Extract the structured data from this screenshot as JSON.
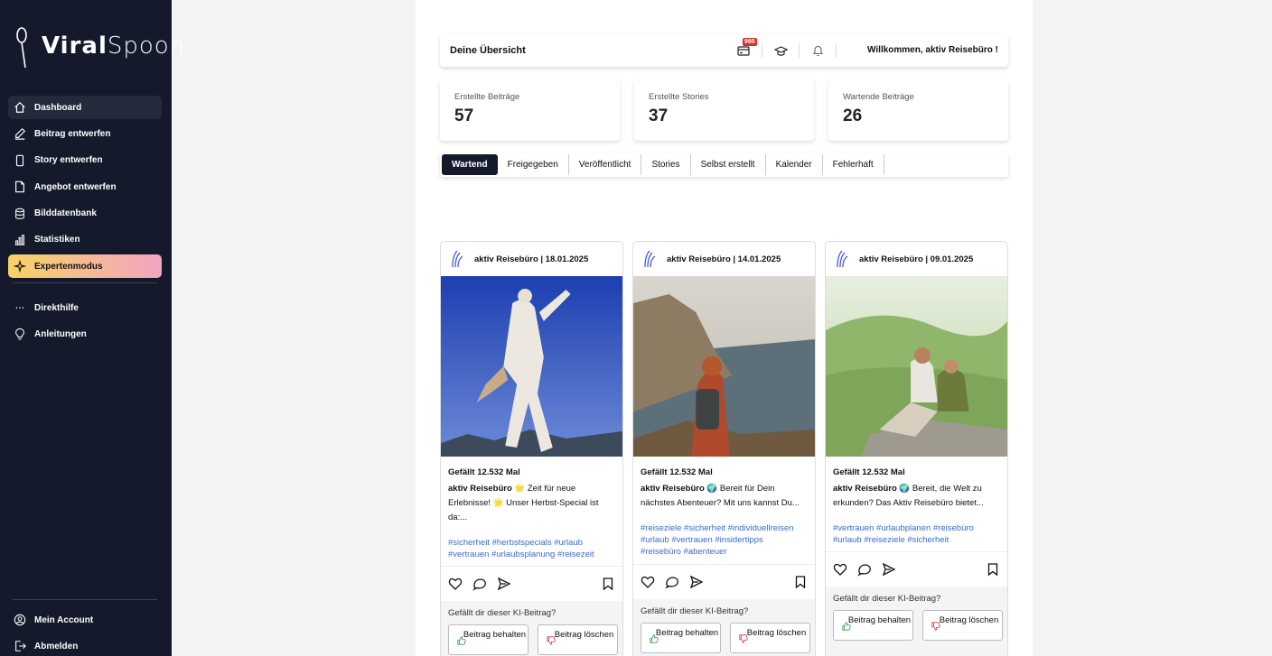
{
  "brand": {
    "part1": "Viral",
    "part2": "Spoon"
  },
  "sidebar": {
    "items": [
      {
        "label": "Dashboard",
        "icon": "home-icon"
      },
      {
        "label": "Beitrag entwerfen",
        "icon": "edit-icon"
      },
      {
        "label": "Story entwerfen",
        "icon": "phone-icon"
      },
      {
        "label": "Angebot entwerfen",
        "icon": "document-icon"
      },
      {
        "label": "Bilddatenbank",
        "icon": "database-icon"
      },
      {
        "label": "Statistiken",
        "icon": "bar-chart-icon"
      },
      {
        "label": "Expertenmodus",
        "icon": "sparkle-icon"
      }
    ],
    "help": [
      {
        "label": "Direkthilfe",
        "icon": "dots-icon"
      },
      {
        "label": "Anleitungen",
        "icon": "lightbulb-icon"
      }
    ],
    "bottom": [
      {
        "label": "Mein Account",
        "icon": "user-icon"
      },
      {
        "label": "Abmelden",
        "icon": "logout-icon"
      }
    ]
  },
  "header": {
    "title": "Deine Übersicht",
    "badge_count": "995",
    "welcome": "Willkommen, aktiv Reisebüro !"
  },
  "stats": [
    {
      "label": "Erstellte Beiträge",
      "value": "57"
    },
    {
      "label": "Erstellte Stories",
      "value": "37"
    },
    {
      "label": "Wartende Beiträge",
      "value": "26"
    }
  ],
  "tabs": [
    "Wartend",
    "Freigegeben",
    "Veröffentlicht",
    "Stories",
    "Selbst erstellt",
    "Kalender",
    "Fehlerhaft"
  ],
  "posts": [
    {
      "author": "aktiv Reisebüro | 18.01.2025",
      "likes": "Gefällt 12.532 Mal",
      "name": "aktiv Reisebüro",
      "caption": "🌟 Zeit für neue Erlebnisse! 🌟 Unser Herbst-Special ist da:...",
      "tags_line1": "#sicherheit #herbstspecials #urlaub",
      "tags_line2": "#vertrauen #urlaubsplanung #reisezeit",
      "tags_line3": "",
      "question": "Gefällt dir dieser KI-Beitrag?",
      "keep": "Beitrag behalten",
      "delete": "Beitrag löschen"
    },
    {
      "author": "aktiv Reisebüro | 14.01.2025",
      "likes": "Gefällt 12.532 Mal",
      "name": "aktiv Reisebüro",
      "caption": "🌍 Bereit für Dein nächstes Abenteuer? Mit uns kannst Du...",
      "tags_line1": "#reiseziele #sicherheit #individuellreisen",
      "tags_line2": "#urlaub #vertrauen #insidertipps",
      "tags_line3": "#reisebüro #abenteuer",
      "question": "Gefällt dir dieser KI-Beitrag?",
      "keep": "Beitrag behalten",
      "delete": "Beitrag löschen"
    },
    {
      "author": "aktiv Reisebüro | 09.01.2025",
      "likes": "Gefällt 12.532 Mal",
      "name": "aktiv Reisebüro",
      "caption": "🌍 Bereit, die Welt zu erkunden? Das Aktiv Reisebüro bietet...",
      "tags_line1": "#vertrauen #urlaubplanen #reisebüro",
      "tags_line2": "#urlaub #reiseziele #sicherheit",
      "tags_line3": "",
      "question": "Gefällt dir dieser KI-Beitrag?",
      "keep": "Beitrag behalten",
      "delete": "Beitrag löschen"
    }
  ],
  "colors": {
    "sidebar_bg": "#141a2b",
    "active_tab": "#141a2b",
    "hashtag": "#3b6ccf",
    "badge": "#d32f2f"
  }
}
